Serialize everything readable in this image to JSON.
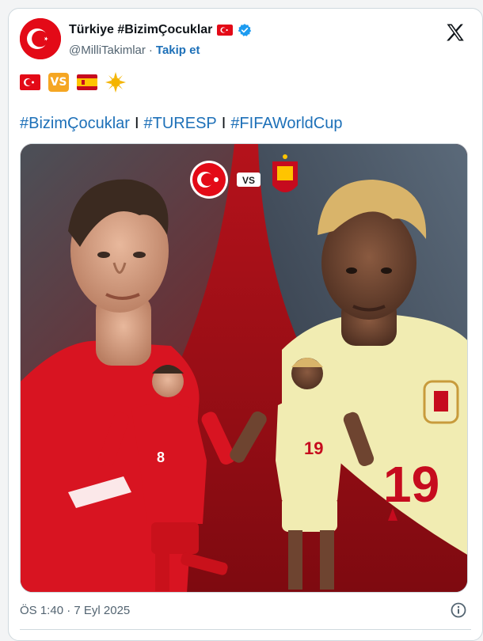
{
  "account": {
    "display_name": "Türkiye #BizimÇocuklar",
    "handle": "@MilliTakimlar",
    "separator": "·",
    "follow_label": "Takip et"
  },
  "emoji_row": {
    "vs_label": "VS",
    "icons": [
      "turkey-flag-icon",
      "vs-icon",
      "spain-flag-icon",
      "sun-icon"
    ]
  },
  "hashtags": {
    "tag1": "#BizimÇocuklar",
    "tag2": "#TURESP",
    "tag3": "#FIFAWorldCup",
    "separator": "I"
  },
  "media": {
    "badge_vs": "VS",
    "left_jersey_number": "8",
    "right_jersey_number_large": "19",
    "right_jersey_number_small": "19"
  },
  "footer": {
    "timestamp": "ÖS 1:40 · 7 Eyl 2025"
  },
  "colors": {
    "turkey_red": "#e30a17",
    "spain_red": "#c60b1e",
    "spain_yellow": "#ffc400",
    "link_blue": "#1d70b8",
    "verified_blue": "#1d9bf0",
    "spain_kit": "#f1ecb2"
  }
}
